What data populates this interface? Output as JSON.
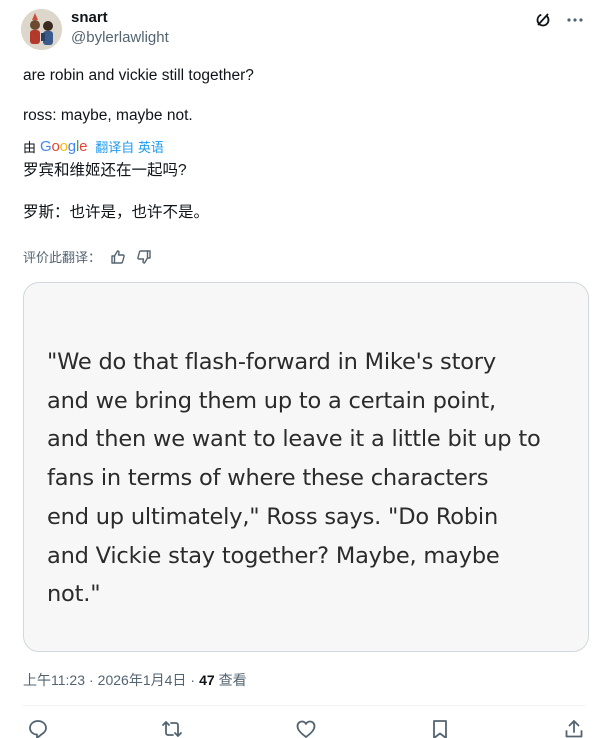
{
  "user": {
    "name": "snart",
    "handle": "@bylerlawlight"
  },
  "tweet": {
    "lines": [
      "are robin and vickie still together?",
      "ross: maybe, maybe not."
    ]
  },
  "translation": {
    "by_label": "由",
    "google_letters": [
      "G",
      "o",
      "o",
      "g",
      "l",
      "e"
    ],
    "google_colors": [
      "#4285F4",
      "#EA4335",
      "#FBBC05",
      "#4285F4",
      "#34A853",
      "#EA4335"
    ],
    "link_label": "翻译自 英语",
    "lines": [
      "罗宾和维姬还在一起吗?",
      "罗斯：也许是，也许不是。"
    ],
    "rate_label": "评价此翻译："
  },
  "media": {
    "quote_lines": [
      "\"We do that flash-forward in Mike's story",
      "and we bring them up to a certain point,",
      "and then we want to leave it a little bit up to",
      "fans in terms of where these characters",
      "end up ultimately,\" Ross says. \"Do Robin",
      "and Vickie stay together? Maybe, maybe",
      "not.\""
    ]
  },
  "meta": {
    "time": "上午11:23",
    "separator": "·",
    "date": "2026年1月4日",
    "views_count": "47",
    "views_label": "查看"
  },
  "colors": {
    "link_blue": "#1d9bf0",
    "muted_gray": "#536471",
    "text": "#0f1419"
  },
  "icons": {
    "top": [
      "grok-icon",
      "more-icon"
    ],
    "rate": [
      "thumbs-up-icon",
      "thumbs-down-icon"
    ],
    "actions": [
      "reply-icon",
      "retweet-icon",
      "like-icon",
      "bookmark-icon",
      "share-icon"
    ]
  }
}
